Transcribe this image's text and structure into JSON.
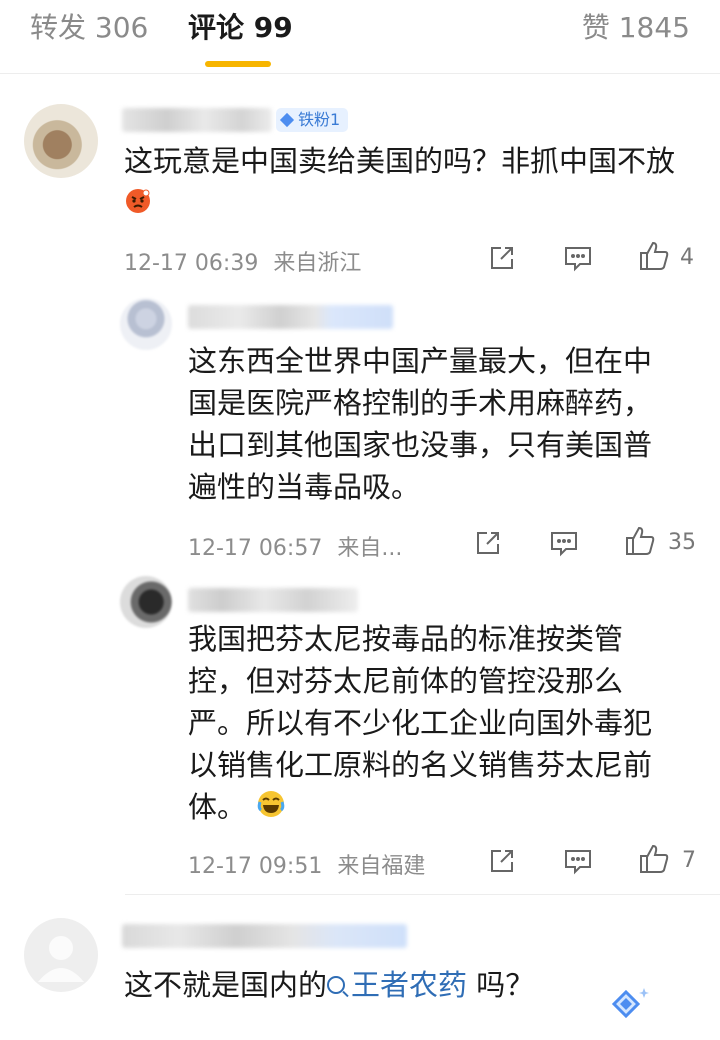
{
  "tabs": {
    "reposts": "转发 306",
    "comments": "评论 99",
    "likes": "赞 1845"
  },
  "comments": [
    {
      "badge": "铁粉1",
      "text": "这玩意是中国卖给美国的吗？非抓中国不放",
      "time": "12-17 06:39",
      "location": "来自浙江",
      "likes": "4"
    },
    {
      "text": "这东西全世界中国产量最大，但在中国是医院严格控制的手术用麻醉药，出口到其他国家也没事，只有美国普遍性的当毒品吸。",
      "time": "12-17 06:57",
      "location": "来自...",
      "likes": "35"
    },
    {
      "text": "我国把芬太尼按毒品的标准按类管控，但对芬太尼前体的管控没那么严。所以有不少化工企业向国外毒犯以销售化工原料的名义销售芬太尼前体。",
      "time": "12-17 09:51",
      "location": "来自福建",
      "likes": "7"
    },
    {
      "text_before": "这不就是国内的",
      "link": "王者农药",
      "text_after": " 吗？"
    }
  ],
  "colors": {
    "accent_underline": "#f7b500",
    "badge_text": "#3a7bd5",
    "link": "#2f6db5"
  }
}
